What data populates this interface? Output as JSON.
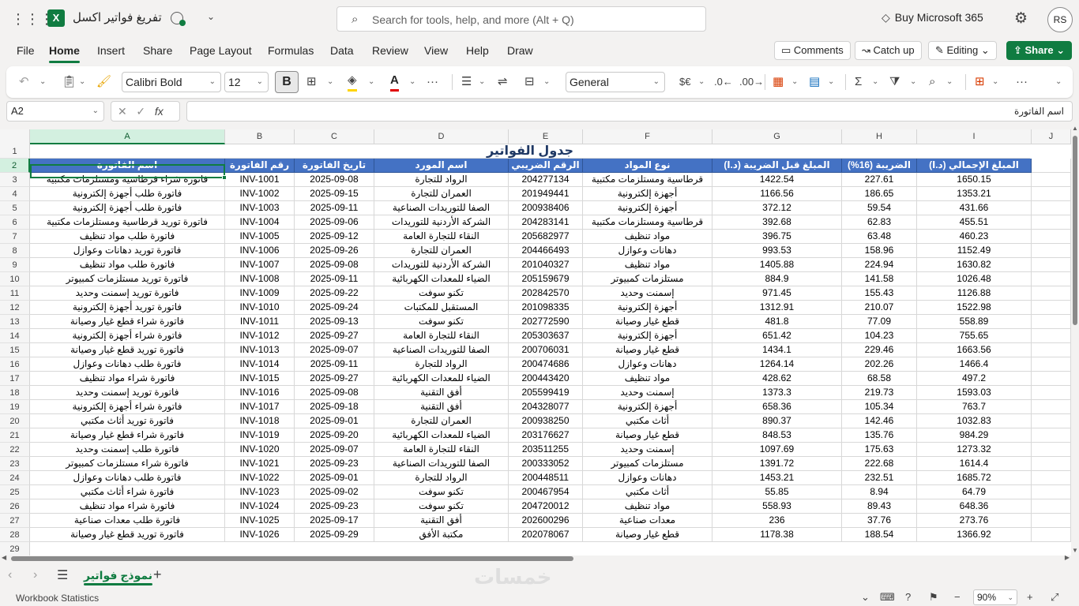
{
  "app": {
    "doc_title": "تفريغ فواتير اكسل",
    "search_placeholder": "Search for tools, help, and more (Alt + Q)",
    "buy_label": "Buy Microsoft 365",
    "avatar_initials": "RS"
  },
  "menu": {
    "tabs": [
      "File",
      "Home",
      "Insert",
      "Share",
      "Page Layout",
      "Formulas",
      "Data",
      "Review",
      "View",
      "Help",
      "Draw"
    ],
    "active": "Home",
    "comments_label": "Comments",
    "catchup_label": "Catch up",
    "editing_label": "Editing",
    "share_label": "Share"
  },
  "ribbon": {
    "font_name": "Calibri Bold",
    "font_size": "12",
    "bold_label": "B",
    "number_format": "General",
    "currency_label": "$€"
  },
  "formula_bar": {
    "cell_ref": "A2",
    "fx_label": "fx",
    "content": "اسم الفاتورة"
  },
  "grid": {
    "columns": [
      "A",
      "B",
      "C",
      "D",
      "E",
      "F",
      "G",
      "H",
      "I",
      "J"
    ],
    "selected_column": "A",
    "selected_row": 2,
    "title": "جدول الفواتير",
    "headers": [
      "اسم الفاتورة",
      "رقم الفاتورة",
      "تاريخ الفاتورة",
      "اسم المورد",
      "الرقم الضريبي",
      "نوع المواد",
      "المبلغ قبل الضريبة (د.ا)",
      "الضريبة (16%)",
      "المبلغ الإجمالي (د.ا)"
    ],
    "rows": [
      [
        "فاتورة شراء قرطاسية ومستلزمات مكتبية",
        "INV-1001",
        "2025-09-08",
        "الرواد للتجارة",
        "204277134",
        "قرطاسية ومستلزمات مكتبية",
        "1422.54",
        "227.61",
        "1650.15"
      ],
      [
        "فاتورة طلب أجهزة إلكترونية",
        "INV-1002",
        "2025-09-15",
        "العمران للتجارة",
        "201949441",
        "أجهزة إلكترونية",
        "1166.56",
        "186.65",
        "1353.21"
      ],
      [
        "فاتورة طلب أجهزة إلكترونية",
        "INV-1003",
        "2025-09-11",
        "الصفا للتوريدات الصناعية",
        "200938406",
        "أجهزة إلكترونية",
        "372.12",
        "59.54",
        "431.66"
      ],
      [
        "فاتورة توريد قرطاسية ومستلزمات مكتبية",
        "INV-1004",
        "2025-09-06",
        "الشركة الأردنية للتوريدات",
        "204283141",
        "قرطاسية ومستلزمات مكتبية",
        "392.68",
        "62.83",
        "455.51"
      ],
      [
        "فاتورة طلب مواد تنظيف",
        "INV-1005",
        "2025-09-12",
        "النقاء للتجارة العامة",
        "205682977",
        "مواد تنظيف",
        "396.75",
        "63.48",
        "460.23"
      ],
      [
        "فاتورة توريد دهانات وعوازل",
        "INV-1006",
        "2025-09-26",
        "العمران للتجارة",
        "204466493",
        "دهانات وعوازل",
        "993.53",
        "158.96",
        "1152.49"
      ],
      [
        "فاتورة طلب مواد تنظيف",
        "INV-1007",
        "2025-09-08",
        "الشركة الأردنية للتوريدات",
        "201040327",
        "مواد تنظيف",
        "1405.88",
        "224.94",
        "1630.82"
      ],
      [
        "فاتورة توريد مستلزمات كمبيوتر",
        "INV-1008",
        "2025-09-11",
        "الضياء للمعدات الكهربائية",
        "205159679",
        "مستلزمات كمبيوتر",
        "884.9",
        "141.58",
        "1026.48"
      ],
      [
        "فاتورة توريد إسمنت وحديد",
        "INV-1009",
        "2025-09-22",
        "تكنو سوفت",
        "202842570",
        "إسمنت وحديد",
        "971.45",
        "155.43",
        "1126.88"
      ],
      [
        "فاتورة توريد أجهزة إلكترونية",
        "INV-1010",
        "2025-09-24",
        "المستقبل للمكتبات",
        "201098335",
        "أجهزة إلكترونية",
        "1312.91",
        "210.07",
        "1522.98"
      ],
      [
        "فاتورة شراء قطع غيار وصيانة",
        "INV-1011",
        "2025-09-13",
        "تكنو سوفت",
        "202772590",
        "قطع غيار وصيانة",
        "481.8",
        "77.09",
        "558.89"
      ],
      [
        "فاتورة شراء أجهزة إلكترونية",
        "INV-1012",
        "2025-09-27",
        "النقاء للتجارة العامة",
        "205303637",
        "أجهزة إلكترونية",
        "651.42",
        "104.23",
        "755.65"
      ],
      [
        "فاتورة توريد قطع غيار وصيانة",
        "INV-1013",
        "2025-09-07",
        "الصفا للتوريدات الصناعية",
        "200706031",
        "قطع غيار وصيانة",
        "1434.1",
        "229.46",
        "1663.56"
      ],
      [
        "فاتورة طلب دهانات وعوازل",
        "INV-1014",
        "2025-09-11",
        "الرواد للتجارة",
        "200474686",
        "دهانات وعوازل",
        "1264.14",
        "202.26",
        "1466.4"
      ],
      [
        "فاتورة شراء مواد تنظيف",
        "INV-1015",
        "2025-09-27",
        "الضياء للمعدات الكهربائية",
        "200443420",
        "مواد تنظيف",
        "428.62",
        "68.58",
        "497.2"
      ],
      [
        "فاتورة توريد إسمنت وحديد",
        "INV-1016",
        "2025-09-08",
        "أفق التقنية",
        "205599419",
        "إسمنت وحديد",
        "1373.3",
        "219.73",
        "1593.03"
      ],
      [
        "فاتورة شراء أجهزة إلكترونية",
        "INV-1017",
        "2025-09-18",
        "أفق التقنية",
        "204328077",
        "أجهزة إلكترونية",
        "658.36",
        "105.34",
        "763.7"
      ],
      [
        "فاتورة توريد أثاث مكتبي",
        "INV-1018",
        "2025-09-01",
        "العمران للتجارة",
        "200938250",
        "أثاث مكتبي",
        "890.37",
        "142.46",
        "1032.83"
      ],
      [
        "فاتورة شراء قطع غيار وصيانة",
        "INV-1019",
        "2025-09-20",
        "الضياء للمعدات الكهربائية",
        "203176627",
        "قطع غيار وصيانة",
        "848.53",
        "135.76",
        "984.29"
      ],
      [
        "فاتورة طلب إسمنت وحديد",
        "INV-1020",
        "2025-09-07",
        "النقاء للتجارة العامة",
        "203511255",
        "إسمنت وحديد",
        "1097.69",
        "175.63",
        "1273.32"
      ],
      [
        "فاتورة شراء مستلزمات كمبيوتر",
        "INV-1021",
        "2025-09-23",
        "الصفا للتوريدات الصناعية",
        "200333052",
        "مستلزمات كمبيوتر",
        "1391.72",
        "222.68",
        "1614.4"
      ],
      [
        "فاتورة طلب دهانات وعوازل",
        "INV-1022",
        "2025-09-01",
        "الرواد للتجارة",
        "200448511",
        "دهانات وعوازل",
        "1453.21",
        "232.51",
        "1685.72"
      ],
      [
        "فاتورة شراء أثاث مكتبي",
        "INV-1023",
        "2025-09-02",
        "تكنو سوفت",
        "200467954",
        "أثاث مكتبي",
        "55.85",
        "8.94",
        "64.79"
      ],
      [
        "فاتورة شراء مواد تنظيف",
        "INV-1024",
        "2025-09-23",
        "تكنو سوفت",
        "204720012",
        "مواد تنظيف",
        "558.93",
        "89.43",
        "648.36"
      ],
      [
        "فاتورة طلب معدات صناعية",
        "INV-1025",
        "2025-09-17",
        "أفق التقنية",
        "202600296",
        "معدات صناعية",
        "236",
        "37.76",
        "273.76"
      ],
      [
        "فاتورة توريد قطع غيار وصيانة",
        "INV-1026",
        "2025-09-29",
        "مكتبة الأفق",
        "202078067",
        "قطع غيار وصيانة",
        "1178.38",
        "188.54",
        "1366.92"
      ]
    ]
  },
  "sheets": {
    "active_tab": "نموذج فواتير",
    "watermark": "خمسات"
  },
  "status": {
    "workbook_stats": "Workbook Statistics",
    "zoom": "90%"
  }
}
